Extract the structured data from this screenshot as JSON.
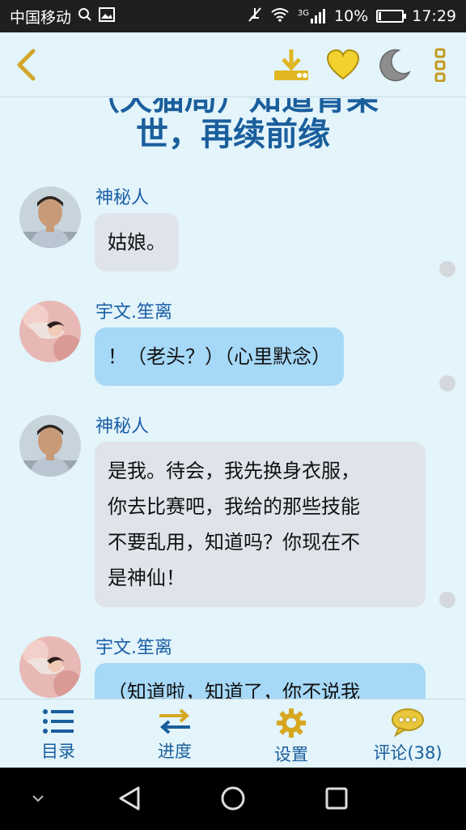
{
  "status_bar": {
    "carrier": "中国移动",
    "network": "3G",
    "battery": "10%",
    "battery_level": 0.1,
    "time": "17:29"
  },
  "toolbar": {
    "icons": [
      "back-icon",
      "download-icon",
      "heart-icon",
      "moon-icon",
      "more-icon"
    ],
    "colors": {
      "back": "#d2a528",
      "download": "#e0b722",
      "heart": "#f2d12e",
      "moon": "#8d8d8d",
      "more": "#c59a1c"
    }
  },
  "chapter": {
    "title_line1": "（天猫局）知道青果",
    "title_line2": "世，再续前缘"
  },
  "messages": [
    {
      "sender": "神秘人",
      "text": "姑娘。",
      "side": "grey"
    },
    {
      "sender": "宇文.笙离",
      "text": "！（老头？）（心里默念）",
      "side": "blue"
    },
    {
      "sender": "神秘人",
      "lines": [
        "是我。待会，我先换身衣服，",
        "你去比赛吧，我给的那些技能",
        "不要乱用，知道吗？你现在不",
        "是神仙！"
      ],
      "side": "grey"
    },
    {
      "sender": "宇文.笙离",
      "text": "（知道啦，知道了，你不说我",
      "side": "blue"
    }
  ],
  "bottom_nav": {
    "items": [
      {
        "label": "目录",
        "icon": "list-icon"
      },
      {
        "label": "进度",
        "icon": "arrows-icon"
      },
      {
        "label": "设置",
        "icon": "gear-icon"
      },
      {
        "label": "评论(38)",
        "icon": "chat-icon"
      }
    ]
  },
  "colors": {
    "background": "#e3f4fb",
    "accent": "#1a5e9c",
    "bubble_grey": "#dfe3ea",
    "bubble_blue": "#a6d8f7"
  }
}
